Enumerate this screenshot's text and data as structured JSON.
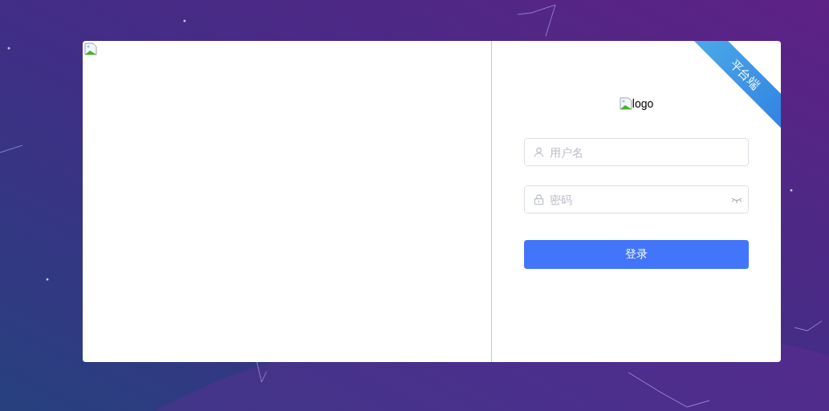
{
  "ribbon": {
    "label": "平台端"
  },
  "logo": {
    "alt": "logo"
  },
  "fields": [
    {
      "kind": "user",
      "placeholder": "用户名"
    },
    {
      "kind": "password",
      "placeholder": "密码"
    }
  ],
  "button": {
    "label": "登录"
  }
}
